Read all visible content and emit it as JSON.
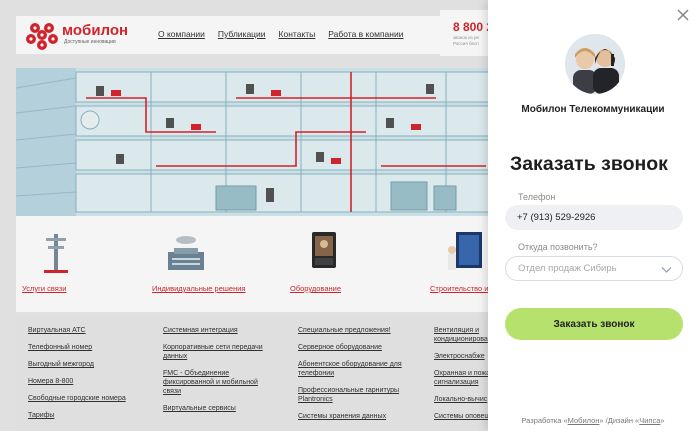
{
  "site": {
    "logo": {
      "name": "мобилон",
      "tagline": "Доступные инновации"
    },
    "nav": [
      "О компании",
      "Публикации",
      "Контакты",
      "Работа в компании"
    ],
    "phone": {
      "number": "8 800 2",
      "sub_line1": "звонок из ре",
      "sub_line2": "Россия бесп"
    },
    "services": [
      {
        "label": "Услуги связи",
        "icon": "antenna-tower-icon"
      },
      {
        "label": "Индивидуальные решения",
        "icon": "building-icon"
      },
      {
        "label": "Оборудование",
        "icon": "video-phone-icon"
      },
      {
        "label": "Строительство ин",
        "icon": "construction-icon"
      }
    ],
    "link_columns": [
      [
        "Виртуальная АТС",
        "Телефонный номер",
        "Выгодный межгород",
        "Номера 8-800",
        "Свободные городские номера",
        "Тарифы"
      ],
      [
        "Системная интеграция",
        "Корпоративные сети передачи данных",
        "FMC - Объединение фиксированной и мобильной связи",
        "Виртуальные сервисы"
      ],
      [
        "Специальные предложения!",
        "Серверное оборудование",
        "Абонентское оборудование для телефонии",
        "Профессиональные гарнитуры Plantronics",
        "Системы хранения данных"
      ],
      [
        "Вентиляция и кондиционирова",
        "Электроснабже",
        "Охранная и пожа сигнализация",
        "Локально-вычис",
        "Системы оповещ"
      ]
    ]
  },
  "panel": {
    "company": "Мобилон Телекоммуникации",
    "title": "Заказать звонок",
    "phone_label": "Телефон",
    "phone_value": "+7 (913) 529-2926",
    "from_label": "Откуда позвонить?",
    "from_value": "Отдел продаж Сибирь",
    "submit_label": "Заказать звонок",
    "credits": {
      "prefix": "Разработка «",
      "dev": "Мобилон",
      "middle": "» /Дизайн «",
      "design": "Чипса",
      "suffix": "»"
    }
  },
  "colors": {
    "brand_red": "#d9262f",
    "submit_green": "#b6e16c"
  }
}
